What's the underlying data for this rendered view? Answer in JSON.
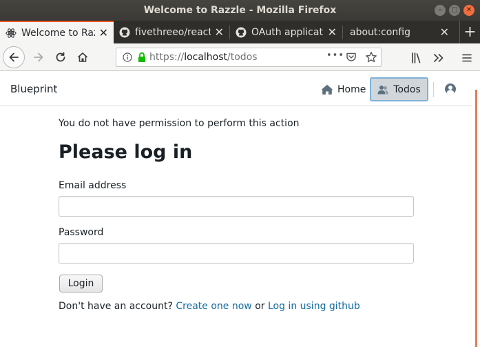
{
  "window": {
    "title": "Welcome to Razzle - Mozilla Firefox",
    "controls": {
      "minimize": "–",
      "maximize": "□",
      "close": "✕"
    }
  },
  "tabs": [
    {
      "label": "Welcome to Razzle",
      "icon": "react-icon",
      "active": true
    },
    {
      "label": "fivethreeo/react",
      "icon": "github-icon",
      "active": false
    },
    {
      "label": "OAuth applicati",
      "icon": "github-icon",
      "active": false
    },
    {
      "label": "about:config",
      "icon": "",
      "active": false
    }
  ],
  "newtab_label": "+",
  "urlbar": {
    "scheme": "https://",
    "host": "localhost",
    "path": "/todos",
    "more_label": "•••"
  },
  "app": {
    "brand": "Blueprint",
    "nav": {
      "home": "Home",
      "todos": "Todos"
    }
  },
  "content": {
    "message": "You do not have permission to perform this action",
    "heading": "Please log in",
    "email_label": "Email address",
    "password_label": "Password",
    "login_button": "Login",
    "footer_prefix": "Don't have an account?",
    "create_link": "Create one now",
    "or_text": "or",
    "github_link": "Log in using github"
  },
  "colors": {
    "accent": "#e95420",
    "link": "#106ba3",
    "active_nav_bg": "#d1d6db",
    "active_nav_border": "#7eb1d6"
  }
}
